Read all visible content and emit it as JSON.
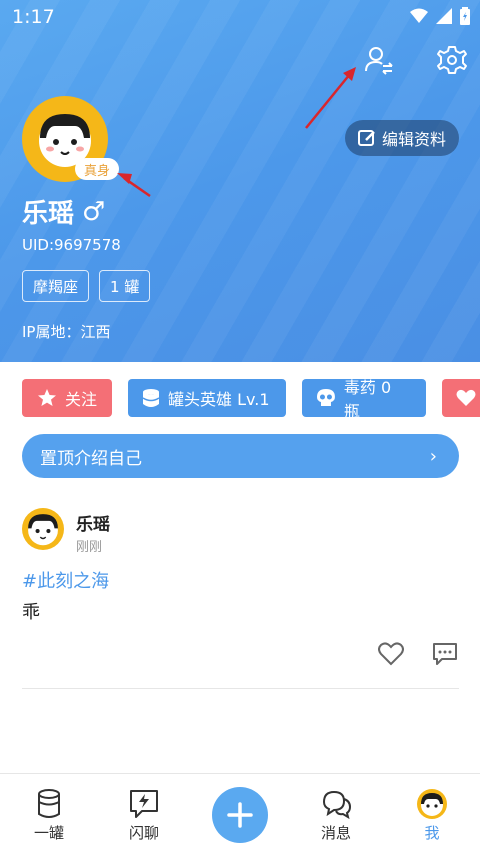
{
  "status": {
    "time": "1:17"
  },
  "profile": {
    "edit_label": "编辑资料",
    "real_badge": "真身",
    "name": "乐瑶",
    "gender_symbol": "♂",
    "uid": "UID:9697578",
    "tags": [
      "摩羯座",
      "1 罐"
    ],
    "ip": "IP属地：江西"
  },
  "actions": {
    "follow": "关注",
    "hero": "罐头英雄 Lv.1",
    "poison": "毒药 0 瓶"
  },
  "intro": {
    "label": "置顶介绍自己",
    "chevron": "›"
  },
  "post": {
    "author": "乐瑶",
    "time": "刚刚",
    "topic": "#此刻之海",
    "text": "乖"
  },
  "nav": {
    "items": [
      "一罐",
      "闪聊",
      "消息",
      "我"
    ]
  },
  "colors": {
    "primary": "#4c98ea",
    "accent_red": "#f46f76",
    "avatar_yellow": "#f5b718",
    "arrow_red": "#d9262c"
  },
  "icons": [
    "user-switch-icon",
    "gear-icon",
    "edit-icon",
    "star-icon",
    "can-icon",
    "skull-icon",
    "heart-icon",
    "comment-icon",
    "chat-flash-icon",
    "message-icon",
    "plus-icon"
  ]
}
